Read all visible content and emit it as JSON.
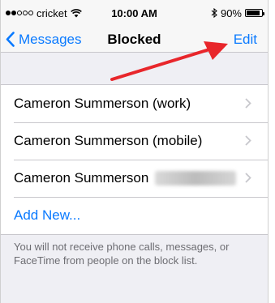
{
  "status_bar": {
    "carrier": "cricket",
    "time": "10:00 AM",
    "battery_text": "90%",
    "battery_level": 0.9,
    "signal_bars_filled": 2,
    "signal_bars_total": 5
  },
  "nav": {
    "back_label": "Messages",
    "title": "Blocked",
    "edit_label": "Edit"
  },
  "blocked_list": {
    "contacts": [
      "Cameron Summerson (work)",
      "Cameron Summerson (mobile)",
      "Cameron Summerson"
    ],
    "add_new_label": "Add New..."
  },
  "footer_note": "You will not receive phone calls, messages, or FaceTime from people on the block list.",
  "colors": {
    "ios_blue": "#0a7aff",
    "annotation_red": "#e8262b",
    "background_gray": "#efeff4"
  },
  "icons": [
    "wifi-icon",
    "bluetooth-icon",
    "battery-icon",
    "chevron-left-icon",
    "chevron-right-icon",
    "arrow-annotation"
  ]
}
